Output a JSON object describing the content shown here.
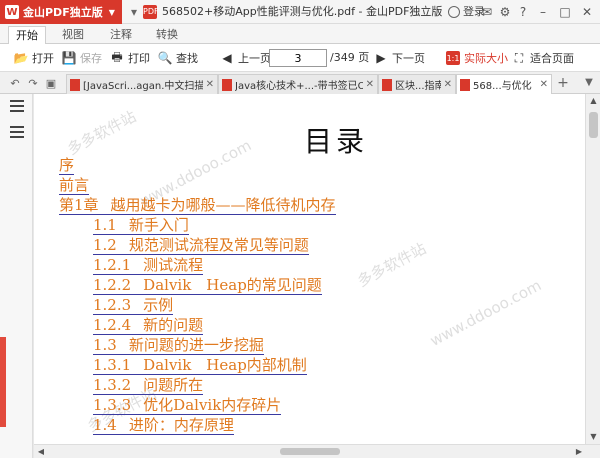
{
  "app": {
    "name": "金山PDF独立版",
    "logo_glyph": "W"
  },
  "window": {
    "title": "568502+移动App性能评测与优化.pdf - 金山PDF独立版",
    "login_label": "登录"
  },
  "ribbon_tabs": [
    {
      "label": "开始",
      "active": true
    },
    {
      "label": "视图",
      "active": false
    },
    {
      "label": "注释",
      "active": false
    },
    {
      "label": "转换",
      "active": false
    }
  ],
  "toolbar": {
    "open": "打开",
    "save": "保存",
    "print": "打印",
    "find": "查找",
    "prev": "上一页",
    "page_value": "3",
    "page_total": "/349 页",
    "next": "下一页",
    "actual_size": "实际大小",
    "fit_page": "适合页面"
  },
  "doc_tabs": [
    {
      "label": "[JavaScri...agan.中文扫描版",
      "active": false
    },
    {
      "label": "Java核心技术+...-带书签已OCR",
      "active": false
    },
    {
      "label": "区块...指南",
      "active": false
    },
    {
      "label": "568...与优化",
      "active": true
    }
  ],
  "document": {
    "title": "目录",
    "entries": [
      {
        "num": "",
        "text": "序",
        "level": 0
      },
      {
        "num": "",
        "text": "前言",
        "level": 0
      },
      {
        "num": "第1章",
        "text": "越用越卡为哪般——降低待机内存",
        "level": 0
      },
      {
        "num": "1.1",
        "text": "新手入门",
        "level": 1
      },
      {
        "num": "1.2",
        "text": "规范测试流程及常见等问题",
        "level": 1
      },
      {
        "num": "1.2.1",
        "text": "测试流程",
        "level": 1
      },
      {
        "num": "1.2.2",
        "text": "Dalvik　Heap的常见问题",
        "level": 1
      },
      {
        "num": "1.2.3",
        "text": "示例",
        "level": 1
      },
      {
        "num": "1.2.4",
        "text": "新的问题",
        "level": 1
      },
      {
        "num": "1.3",
        "text": "新问题的进一步挖掘",
        "level": 1
      },
      {
        "num": "1.3.1",
        "text": "Dalvik　Heap内部机制",
        "level": 1
      },
      {
        "num": "1.3.2",
        "text": "问题所在",
        "level": 1
      },
      {
        "num": "1.3.3",
        "text": "优化Dalvik内存碎片",
        "level": 1
      },
      {
        "num": "1.4",
        "text": "进阶：内存原理",
        "level": 1
      }
    ]
  },
  "watermarks": [
    "多多软件站",
    "www.ddooo.com",
    "多多软件站",
    "www.ddooo.com",
    "多多软件站"
  ],
  "colors": {
    "brand": "#d8382b",
    "toc_link": "#e07a20",
    "toc_underline": "#3a3aa0"
  }
}
